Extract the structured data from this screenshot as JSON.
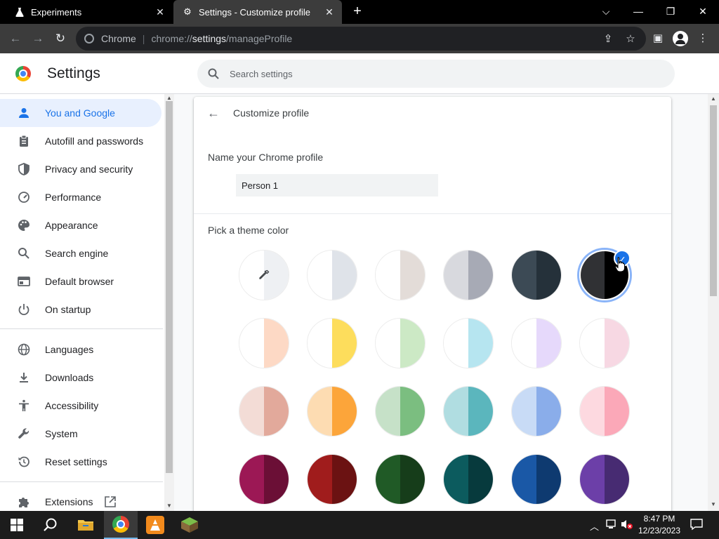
{
  "tabs": [
    {
      "title": "Experiments",
      "icon": "flask-icon"
    },
    {
      "title": "Settings - Customize profile",
      "icon": "gear-icon"
    }
  ],
  "omnibox": {
    "chip": "Chrome",
    "url_prefix": "chrome://",
    "url_bold": "settings",
    "url_suffix": "/manageProfile"
  },
  "header": {
    "title": "Settings",
    "search_placeholder": "Search settings"
  },
  "sidebar": {
    "items": [
      {
        "label": "You and Google",
        "icon": "person-icon",
        "active": true
      },
      {
        "label": "Autofill and passwords",
        "icon": "clipboard-icon"
      },
      {
        "label": "Privacy and security",
        "icon": "shield-icon"
      },
      {
        "label": "Performance",
        "icon": "gauge-icon"
      },
      {
        "label": "Appearance",
        "icon": "palette-icon"
      },
      {
        "label": "Search engine",
        "icon": "search-icon"
      },
      {
        "label": "Default browser",
        "icon": "browser-icon"
      },
      {
        "label": "On startup",
        "icon": "power-icon"
      },
      {
        "label": "Languages",
        "icon": "globe-icon"
      },
      {
        "label": "Downloads",
        "icon": "download-icon"
      },
      {
        "label": "Accessibility",
        "icon": "accessibility-icon"
      },
      {
        "label": "System",
        "icon": "wrench-icon"
      },
      {
        "label": "Reset settings",
        "icon": "reset-icon"
      },
      {
        "label": "Extensions",
        "icon": "puzzle-icon"
      }
    ]
  },
  "page": {
    "title": "Customize profile",
    "name_label": "Name your Chrome profile",
    "name_value": "Person 1",
    "theme_label": "Pick a theme color"
  },
  "themes": [
    {
      "l": "#ffffff",
      "r": "#eef0f3",
      "icon": "eyedropper-icon"
    },
    {
      "l": "#ffffff",
      "r": "#dfe3e9"
    },
    {
      "l": "#ffffff",
      "r": "#e3dcd8"
    },
    {
      "l": "#d8d9de",
      "r": "#a7aab5"
    },
    {
      "l": "#3c4a55",
      "r": "#25313a"
    },
    {
      "l": "#303134",
      "r": "#000000",
      "selected": true
    },
    {
      "l": "#ffffff",
      "r": "#fdd9c5"
    },
    {
      "l": "#ffffff",
      "r": "#fddd5c"
    },
    {
      "l": "#ffffff",
      "r": "#cce9c5"
    },
    {
      "l": "#ffffff",
      "r": "#b6e5f0"
    },
    {
      "l": "#ffffff",
      "r": "#e6d9fb"
    },
    {
      "l": "#ffffff",
      "r": "#f7d8e3"
    },
    {
      "l": "#f3dcd6",
      "r": "#e2a99b"
    },
    {
      "l": "#fddcb2",
      "r": "#fca53a"
    },
    {
      "l": "#c6e1c8",
      "r": "#7bbe80"
    },
    {
      "l": "#b0dde1",
      "r": "#5bb6bd"
    },
    {
      "l": "#c8dbf6",
      "r": "#8aadea"
    },
    {
      "l": "#fdd9e0",
      "r": "#fba8b8"
    },
    {
      "l": "#9c1855",
      "r": "#6b0f36"
    },
    {
      "l": "#a01c1c",
      "r": "#6b1212"
    },
    {
      "l": "#205a26",
      "r": "#163d1a"
    },
    {
      "l": "#0c5b5e",
      "r": "#073a3d"
    },
    {
      "l": "#1a58a6",
      "r": "#0e3a70"
    },
    {
      "l": "#6c3fa8",
      "r": "#472b72"
    }
  ],
  "taskbar": {
    "apps": [
      "windows-start-icon",
      "search-icon",
      "file-explorer-icon",
      "chrome-icon",
      "vlc-icon",
      "minecraft-icon"
    ]
  },
  "clock": {
    "time": "8:47 PM",
    "date": "12/23/2023"
  },
  "colors": {
    "accent": "#1a73e8",
    "active_bg": "#e8f0fe"
  }
}
